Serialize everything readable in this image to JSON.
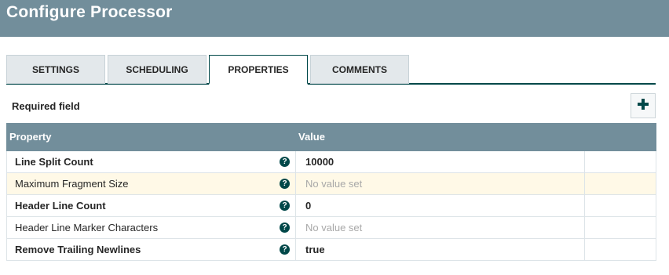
{
  "header": {
    "title": "Configure Processor"
  },
  "tabs": [
    {
      "label": "SETTINGS",
      "active": false
    },
    {
      "label": "SCHEDULING",
      "active": false
    },
    {
      "label": "PROPERTIES",
      "active": true
    },
    {
      "label": "COMMENTS",
      "active": false
    }
  ],
  "required_label": "Required field",
  "table": {
    "columns": {
      "property": "Property",
      "value": "Value"
    },
    "rows": [
      {
        "property": "Line Split Count",
        "value": "10000",
        "required": true
      },
      {
        "property": "Maximum Fragment Size",
        "value": "No value set",
        "required": false
      },
      {
        "property": "Header Line Count",
        "value": "0",
        "required": true
      },
      {
        "property": "Header Line Marker Characters",
        "value": "No value set",
        "required": false
      },
      {
        "property": "Remove Trailing Newlines",
        "value": "true",
        "required": true
      }
    ]
  },
  "colors": {
    "header_bg": "#728e9b",
    "accent": "#004849",
    "highlight_row": "#fff9e7"
  },
  "icons": {
    "add": "plus-icon",
    "help": "help-circle-icon"
  }
}
